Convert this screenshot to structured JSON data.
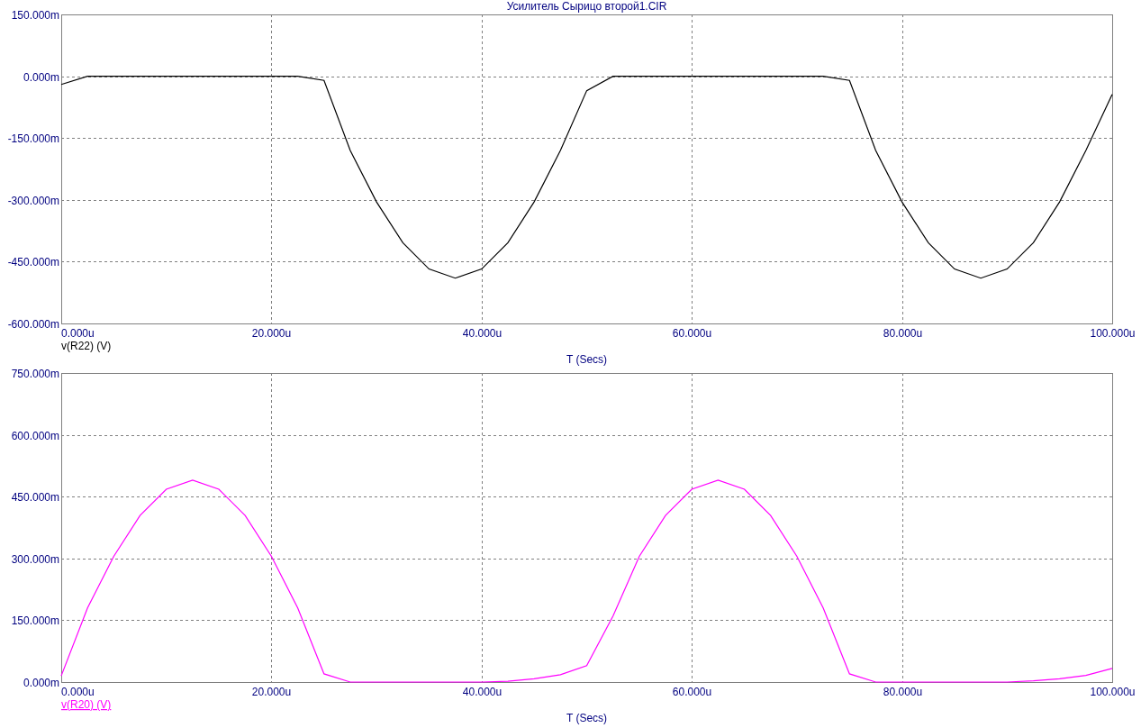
{
  "title": "Усилитель Сырицо второй1.CIR",
  "charts": [
    {
      "trace_label_underlined": false,
      "chart_data": {
        "type": "line",
        "grid": true,
        "xlabel": "T (Secs)",
        "xlim": [
          0,
          100
        ],
        "ylim": [
          -600,
          150
        ],
        "xticks": [
          {
            "value": 0,
            "label": "0.000u"
          },
          {
            "value": 20,
            "label": "20.000u"
          },
          {
            "value": 40,
            "label": "40.000u"
          },
          {
            "value": 60,
            "label": "60.000u"
          },
          {
            "value": 80,
            "label": "80.000u"
          },
          {
            "value": 100,
            "label": "100.000u"
          }
        ],
        "yticks": [
          {
            "value": 150,
            "label": "150.000m"
          },
          {
            "value": 0,
            "label": "0.000m"
          },
          {
            "value": -150,
            "label": "-150.000m"
          },
          {
            "value": -300,
            "label": "-300.000m"
          },
          {
            "value": -450,
            "label": "-450.000m"
          },
          {
            "value": -600,
            "label": "-600.000m"
          }
        ],
        "x": [
          0,
          2.5,
          5,
          7.5,
          10,
          12.5,
          15,
          17.5,
          20,
          22.5,
          25,
          27.5,
          30,
          32.5,
          35,
          37.5,
          40,
          42.5,
          45,
          47.5,
          50,
          52.5,
          55,
          57.5,
          60,
          62.5,
          65,
          67.5,
          70,
          72.5,
          75,
          77.5,
          80,
          82.5,
          85,
          87.5,
          90,
          92.5,
          95,
          97.5,
          100
        ],
        "series": [
          {
            "name": "v(R22) (V)",
            "color": "#000000",
            "values": [
              -20,
              0,
              0,
              0,
              0,
              0,
              0,
              0,
              0,
              0,
              -10,
              -180,
              -305,
              -404,
              -468,
              -490,
              -468,
              -404,
              -305,
              -180,
              -35,
              0,
              0,
              0,
              0,
              0,
              0,
              0,
              0,
              0,
              -10,
              -180,
              -305,
              -404,
              -468,
              -490,
              -468,
              -404,
              -305,
              -180,
              -44
            ]
          }
        ]
      }
    },
    {
      "trace_label_underlined": true,
      "chart_data": {
        "type": "line",
        "grid": true,
        "xlabel": "T (Secs)",
        "xlim": [
          0,
          100
        ],
        "ylim": [
          0,
          750
        ],
        "xticks": [
          {
            "value": 0,
            "label": "0.000u"
          },
          {
            "value": 20,
            "label": "20.000u"
          },
          {
            "value": 40,
            "label": "40.000u"
          },
          {
            "value": 60,
            "label": "60.000u"
          },
          {
            "value": 80,
            "label": "80.000u"
          },
          {
            "value": 100,
            "label": "100.000u"
          }
        ],
        "yticks": [
          {
            "value": 750,
            "label": "750.000m"
          },
          {
            "value": 600,
            "label": "600.000m"
          },
          {
            "value": 450,
            "label": "450.000m"
          },
          {
            "value": 300,
            "label": "300.000m"
          },
          {
            "value": 150,
            "label": "150.000m"
          },
          {
            "value": 0,
            "label": "0.000m"
          }
        ],
        "x": [
          0,
          2.5,
          5,
          7.5,
          10,
          12.5,
          15,
          17.5,
          20,
          22.5,
          25,
          27.5,
          30,
          32.5,
          35,
          37.5,
          40,
          42.5,
          45,
          47.5,
          50,
          52.5,
          55,
          57.5,
          60,
          62.5,
          65,
          67.5,
          70,
          72.5,
          75,
          77.5,
          80,
          82.5,
          85,
          87.5,
          90,
          92.5,
          95,
          97.5,
          100
        ],
        "series": [
          {
            "name": "v(R20) (V)",
            "color": "#ff00ff",
            "values": [
              15,
              180,
              305,
              404,
              468,
              490,
              468,
              404,
              305,
              180,
              20,
              0,
              0,
              0,
              0,
              0,
              0,
              2,
              8,
              18,
              40,
              160,
              305,
              404,
              468,
              490,
              468,
              404,
              305,
              180,
              20,
              0,
              0,
              0,
              0,
              0,
              0,
              3,
              8,
              16,
              33
            ]
          }
        ]
      }
    }
  ]
}
